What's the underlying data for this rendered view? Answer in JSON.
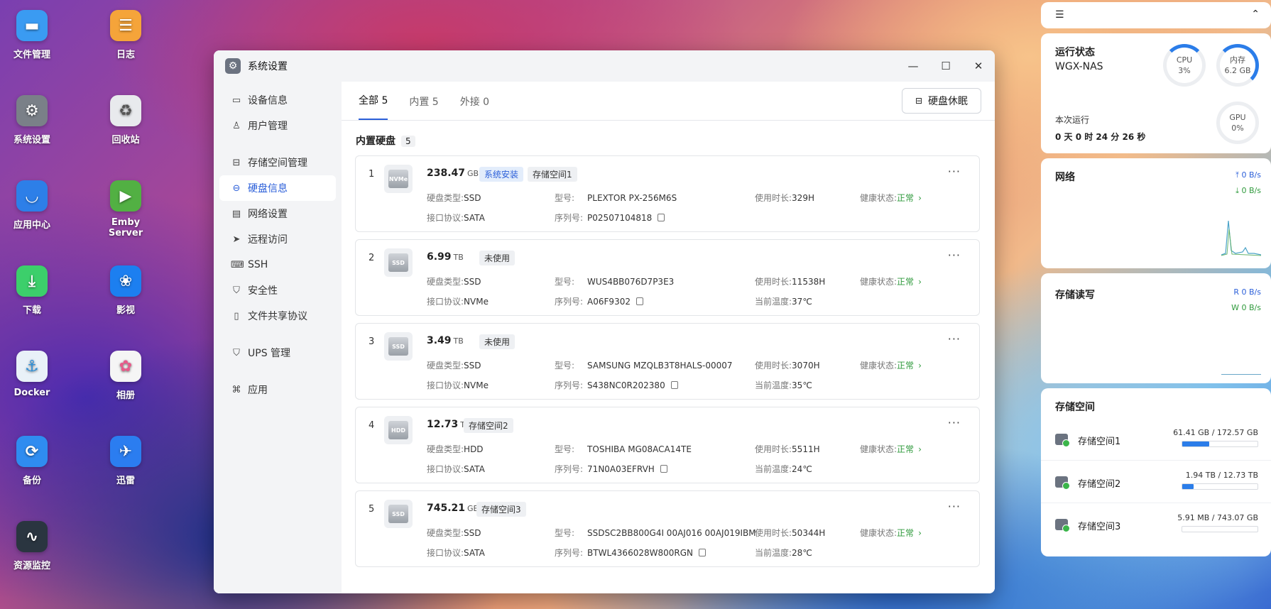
{
  "desktop": {
    "icons": [
      {
        "label": "文件管理",
        "icon": "folder-icon",
        "color": "#3a9bf2"
      },
      {
        "label": "日志",
        "icon": "log-icon",
        "color": "#f5a43a"
      },
      {
        "label": "系统设置",
        "icon": "gear-icon",
        "color": "#7a8088"
      },
      {
        "label": "回收站",
        "icon": "recycle-icon",
        "color": "#e8eaed"
      },
      {
        "label": "应用中心",
        "icon": "store-icon",
        "color": "#2d7fe8"
      },
      {
        "label": "Emby Server",
        "icon": "play-icon",
        "color": "#52b043"
      },
      {
        "label": "下载",
        "icon": "download-icon",
        "color": "#3ccf6b"
      },
      {
        "label": "影视",
        "icon": "video-icon",
        "color": "#1c7ff0"
      },
      {
        "label": "Docker",
        "icon": "docker-icon",
        "color": "#e9f1f8"
      },
      {
        "label": "相册",
        "icon": "photos-icon",
        "color": "#f5f5f5"
      },
      {
        "label": "备份",
        "icon": "backup-icon",
        "color": "#2f8cf0"
      },
      {
        "label": "迅雷",
        "icon": "thunder-icon",
        "color": "#2b7df0"
      },
      {
        "label": "资源监控",
        "icon": "monitor-icon",
        "color": "#2a3540"
      }
    ]
  },
  "window": {
    "title": "系统设置",
    "sidebar": [
      {
        "label": "设备信息",
        "icon": "device-icon",
        "glyph": "▭"
      },
      {
        "label": "用户管理",
        "icon": "user-icon",
        "glyph": "♙"
      },
      {
        "label": "存储空间管理",
        "icon": "storage-icon",
        "glyph": "⊟"
      },
      {
        "label": "硬盘信息",
        "icon": "disk-icon",
        "glyph": "⊖"
      },
      {
        "label": "网络设置",
        "icon": "network-icon",
        "glyph": "▤"
      },
      {
        "label": "远程访问",
        "icon": "send-icon",
        "glyph": "➤"
      },
      {
        "label": "SSH",
        "icon": "terminal-icon",
        "glyph": "⌨"
      },
      {
        "label": "安全性",
        "icon": "shield-check-icon",
        "glyph": "⛉"
      },
      {
        "label": "文件共享协议",
        "icon": "file-icon",
        "glyph": "▯"
      },
      {
        "label": "UPS 管理",
        "icon": "ups-shield-icon",
        "glyph": "⛉"
      },
      {
        "label": "应用",
        "icon": "apps-icon",
        "glyph": "⌘"
      }
    ],
    "tabs": [
      {
        "label": "全部 5"
      },
      {
        "label": "内置 5"
      },
      {
        "label": "外接 0"
      }
    ],
    "sleep_button": "硬盘休眠",
    "section_title": "内置硬盘",
    "section_count": "5",
    "labels": {
      "type": "硬盘类型:",
      "iface": "接口协议:",
      "model": "型号:",
      "serial": "序列号:",
      "hours": "使用时长:",
      "temp": "当前温度:",
      "health": "健康状态:"
    },
    "disks": [
      {
        "idx": "1",
        "size": "238.47",
        "unit": "GB",
        "img": "NVMe",
        "tags": [
          "系统安装",
          "存储空间1"
        ],
        "type": "SSD",
        "iface": "SATA",
        "model": "PLEXTOR PX-256M6S",
        "serial": "P02507104818",
        "hours": "329H",
        "temp": "",
        "health": "正常"
      },
      {
        "idx": "2",
        "size": "6.99",
        "unit": "TB",
        "img": "SSD",
        "tags": [
          "未使用"
        ],
        "type": "SSD",
        "iface": "NVMe",
        "model": "WUS4BB076D7P3E3",
        "serial": "A06F9302",
        "hours": "11538H",
        "temp": "37℃",
        "health": "正常"
      },
      {
        "idx": "3",
        "size": "3.49",
        "unit": "TB",
        "img": "SSD",
        "tags": [
          "未使用"
        ],
        "type": "SSD",
        "iface": "NVMe",
        "model": "SAMSUNG MZQLB3T8HALS-00007",
        "serial": "S438NC0R202380",
        "hours": "3070H",
        "temp": "35℃",
        "health": "正常"
      },
      {
        "idx": "4",
        "size": "12.73",
        "unit": "TB",
        "img": "HDD",
        "tags": [
          "存储空间2"
        ],
        "type": "HDD",
        "iface": "SATA",
        "model": "TOSHIBA MG08ACA14TE",
        "serial": "71N0A03EFRVH",
        "hours": "5511H",
        "temp": "24℃",
        "health": "正常"
      },
      {
        "idx": "5",
        "size": "745.21",
        "unit": "GB",
        "img": "SSD",
        "tags": [
          "存储空间3"
        ],
        "type": "SSD",
        "iface": "SATA",
        "model": "SSDSC2BB800G4I 00AJ016 00AJ019IBM",
        "serial": "BTWL4366028W800RGN",
        "hours": "50344H",
        "temp": "28℃",
        "health": "正常"
      }
    ]
  },
  "widgets": {
    "status": {
      "title": "运行状态",
      "host": "WGX-NAS",
      "uptime_label": "本次运行",
      "uptime": "0 天 0 时 24 分 26 秒",
      "cpu_label": "CPU",
      "cpu_value": "3%",
      "mem_label": "内存",
      "mem_value": "6.2 GB",
      "gpu_label": "GPU",
      "gpu_value": "0%"
    },
    "network": {
      "title": "网络",
      "up": "0 B/s",
      "down": "0 B/s"
    },
    "io": {
      "title": "存储读写",
      "read": "R 0 B/s",
      "write": "W 0 B/s"
    },
    "storage": {
      "title": "存储空间",
      "items": [
        {
          "name": "存储空间1",
          "value": "61.41 GB / 172.57 GB",
          "fraction": 0.36
        },
        {
          "name": "存储空间2",
          "value": "1.94 TB / 12.73 TB",
          "fraction": 0.15
        },
        {
          "name": "存储空间3",
          "value": "5.91 MB / 743.07 GB",
          "fraction": 0.0
        }
      ]
    }
  }
}
